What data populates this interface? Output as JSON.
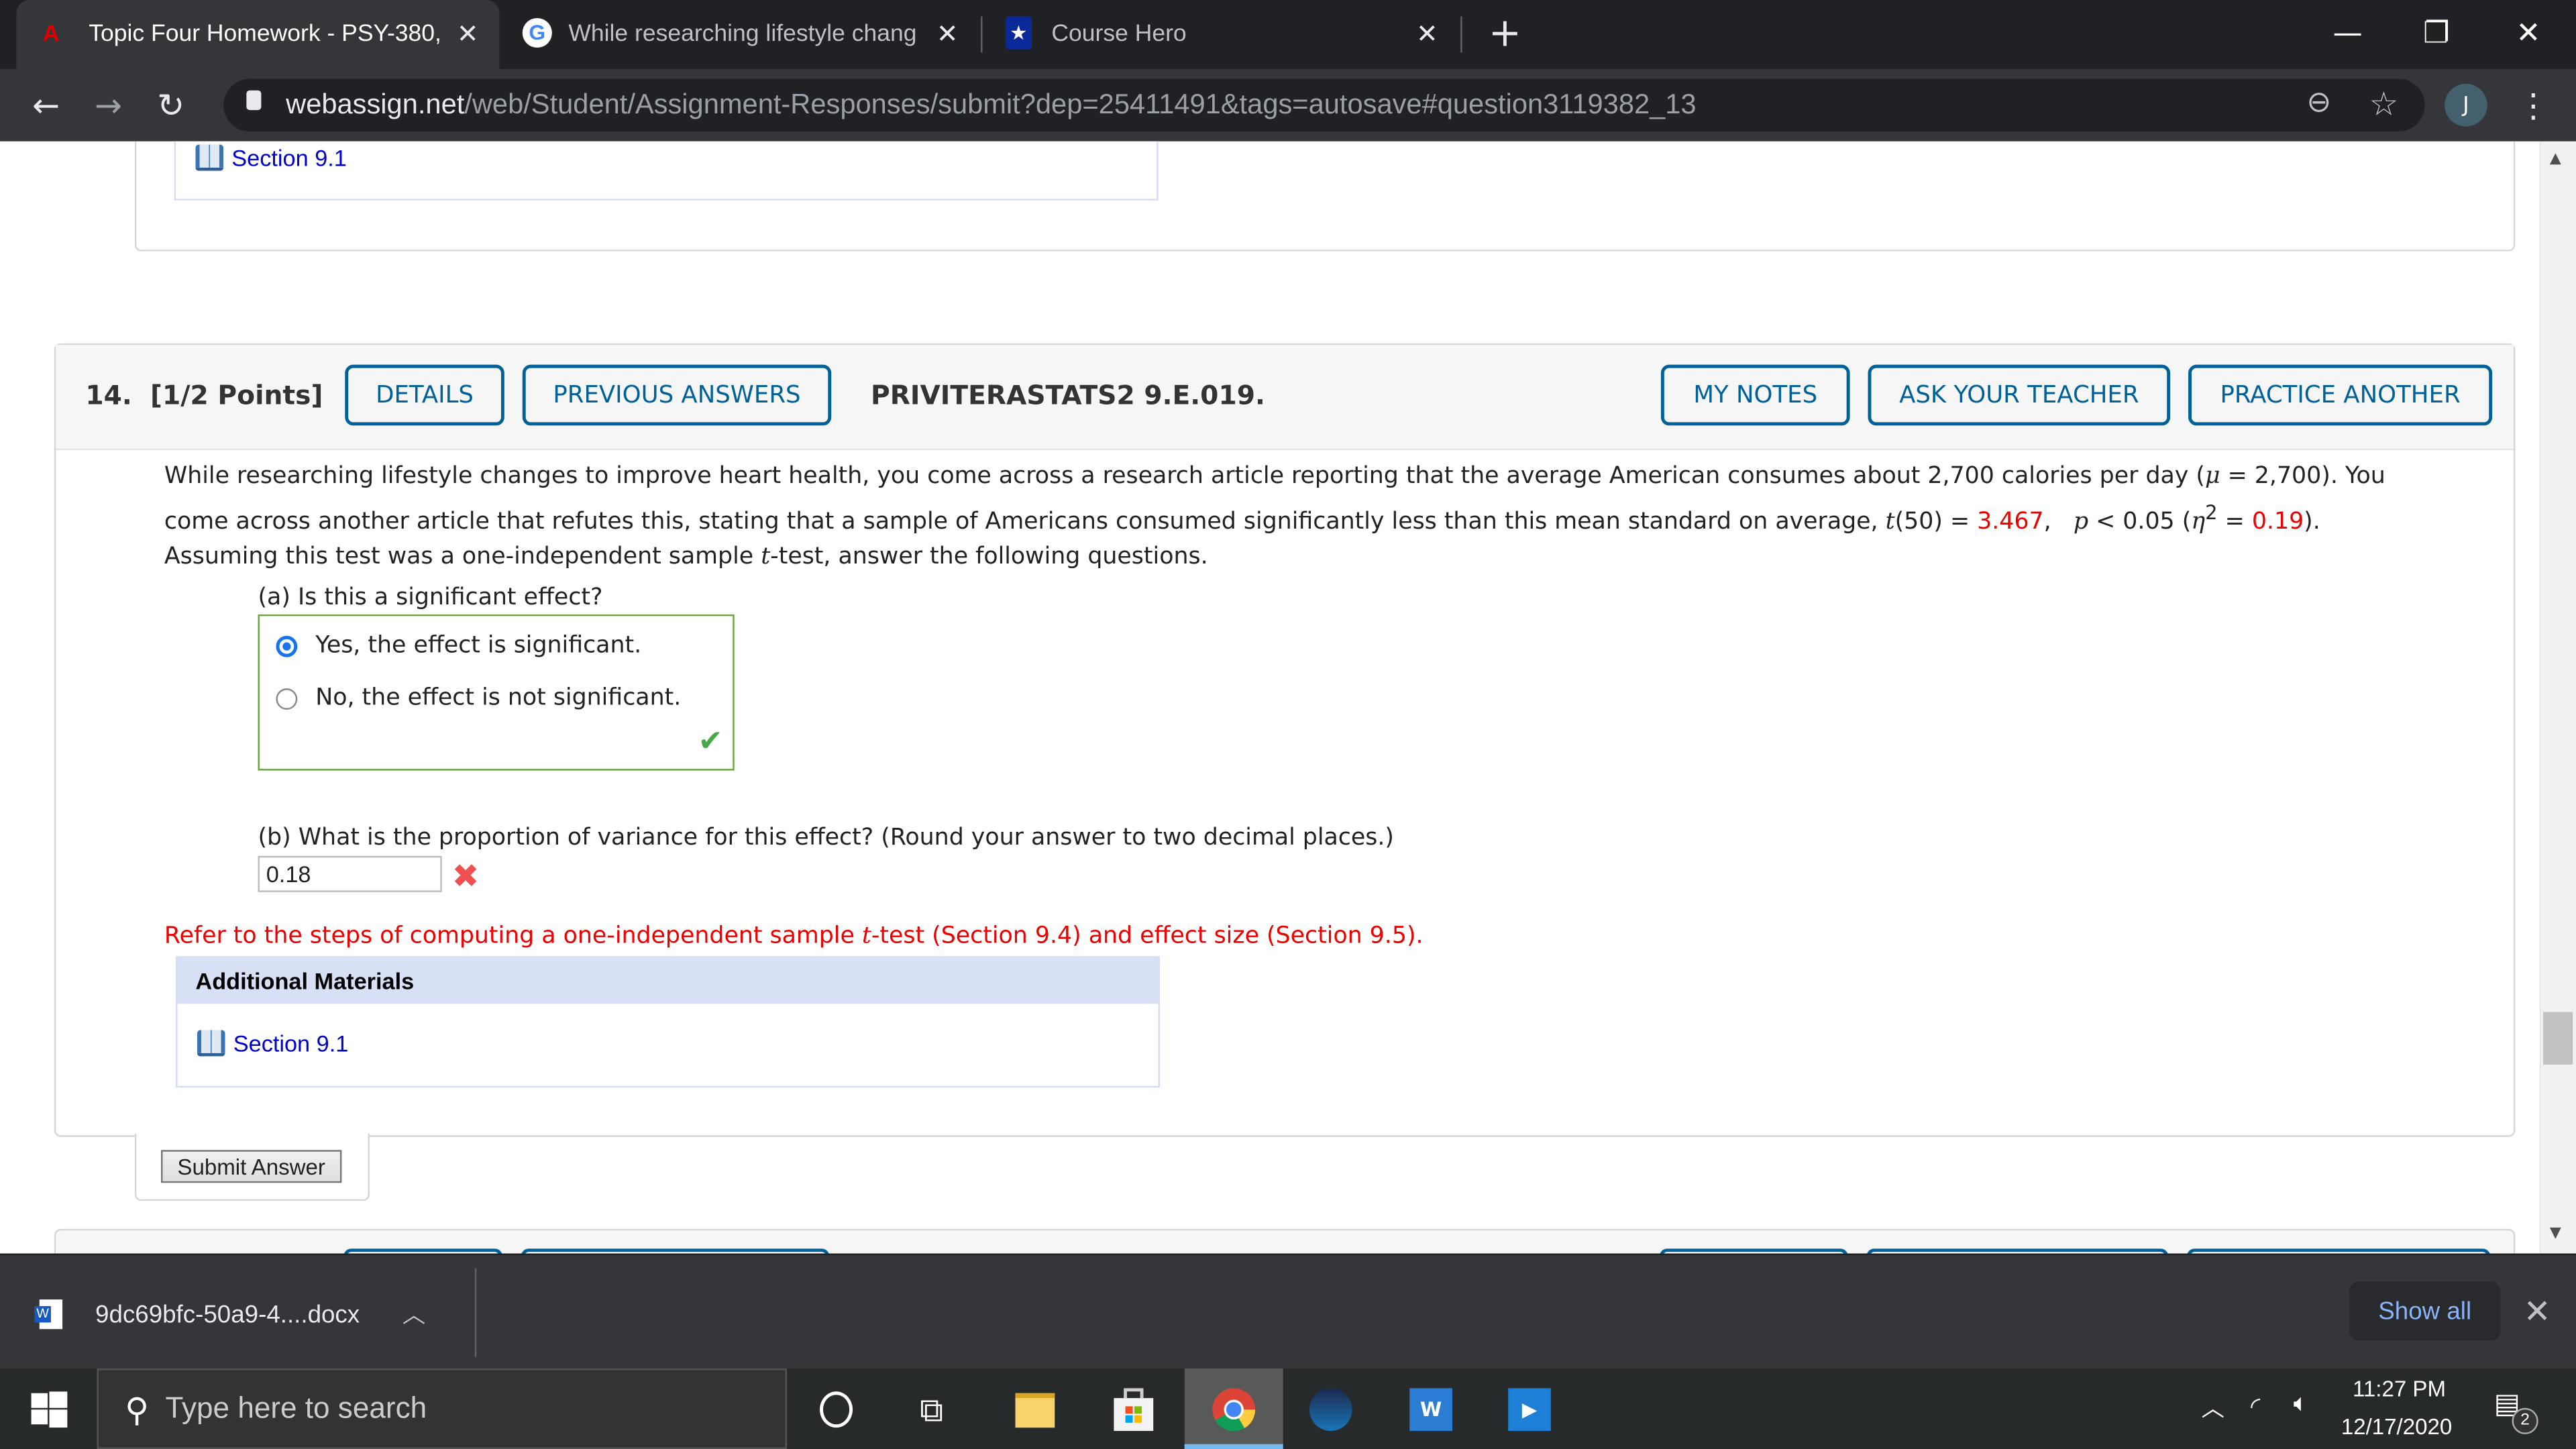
{
  "browser": {
    "tabs": [
      {
        "title": "Topic Four Homework - PSY-380,",
        "icon": "webassign-favicon",
        "active": true
      },
      {
        "title": "While researching lifestyle chang",
        "icon": "google-icon",
        "active": false
      },
      {
        "title": "Course Hero",
        "icon": "coursehero-star-icon",
        "active": false
      }
    ],
    "new_tab": "+",
    "url_host": "webassign.net",
    "url_path": "/web/Student/Assignment-Responses/submit?dep=25411491&tags=autosave#question3119382_13",
    "profile_initial": "J"
  },
  "previous_question": {
    "material_link": "Section 9.1"
  },
  "question": {
    "number": "14.",
    "points": "[1/2 Points]",
    "buttons": {
      "details": "DETAILS",
      "previous_answers": "PREVIOUS ANSWERS",
      "my_notes": "MY NOTES",
      "ask_teacher": "ASK YOUR TEACHER",
      "practice_another": "PRACTICE ANOTHER"
    },
    "code": "PRIVITERASTATS2 9.E.019.",
    "text": {
      "line1_a": "While researching lifestyle changes to improve heart health, you come across a research article reporting that the average American consumes about 2,700 calories per day  (",
      "mu": "μ",
      "line1_b": " = 2,700).  You",
      "line2_a": "come across another article that refutes this, stating that a sample of Americans consumed significantly less than this mean standard on average,  ",
      "t_sym": "t",
      "t_df": "(50) = ",
      "t_value": "3.467",
      "p_part_a": ",   ",
      "p_sym": "p",
      "p_part_b": " < 0.05 (",
      "eta": "η",
      "eta_exp": "2",
      "eq": " = ",
      "eta_value": "0.19",
      "close": ").",
      "line3_a": "Assuming this test was a one-independent sample ",
      "line3_t": "t",
      "line3_b": "-test, answer the following questions."
    },
    "part_a": {
      "label": "(a) Is this a significant effect?",
      "options": [
        {
          "label": "Yes, the effect is significant.",
          "selected": true
        },
        {
          "label": "No, the effect is not significant.",
          "selected": false
        }
      ],
      "status": "correct"
    },
    "part_b": {
      "label": "(b) What is the proportion of variance for this effect? (Round your answer to two decimal places.)",
      "value": "0.18",
      "status": "incorrect"
    },
    "hint": {
      "a": "Refer to the steps of computing a one-independent sample ",
      "t": "t",
      "b": "-test (Section 9.4) and effect size (Section 9.5)."
    },
    "additional_materials": {
      "title": "Additional Materials",
      "link": "Section 9.1"
    },
    "submit": "Submit Answer"
  },
  "downloads": {
    "file": "9dc69bfc-50a9-4....docx",
    "show_all": "Show all"
  },
  "taskbar": {
    "search_placeholder": "Type here to search",
    "time": "11:27 PM",
    "date": "12/17/2020",
    "notifications": "2"
  },
  "colors": {
    "accent": "#006098",
    "error": "#ee0000",
    "correct_border": "#6ba544",
    "link": "#0000cc"
  }
}
